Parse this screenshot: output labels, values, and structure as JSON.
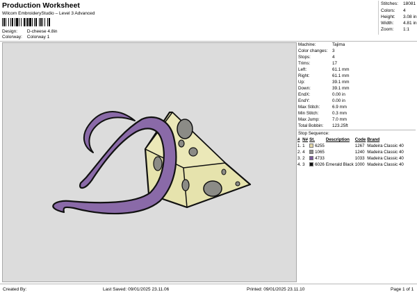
{
  "header": {
    "title": "Production Worksheet",
    "subtitle": "Wilcom EmbroideryStudio – Level 3 Advanced",
    "design_label": "Design:",
    "design_value": "D-cheese 4.8in",
    "colorway_label": "Colorway:",
    "colorway_value": "Colorway 1"
  },
  "stats": {
    "stitches_label": "Stitches:",
    "stitches": "18081",
    "colors_label": "Colors:",
    "colors": "4",
    "height_label": "Height:",
    "height": "3.08 in",
    "width_label": "Width:",
    "width": "4.81 in",
    "zoom_label": "Zoom:",
    "zoom": "1:1"
  },
  "machine_info": {
    "machine_label": "Machine:",
    "machine": "Tajima",
    "color_changes_label": "Color changes:",
    "color_changes": "3",
    "stops_label": "Stops:",
    "stops": "4",
    "trims_label": "Trims:",
    "trims": "17",
    "left_label": "Left:",
    "left": "61.1 mm",
    "right_label": "Right:",
    "right": "61.1 mm",
    "up_label": "Up:",
    "up": "39.1 mm",
    "down_label": "Down:",
    "down": "39.1 mm",
    "endx_label": "EndX:",
    "endx": "0.00 in",
    "endy_label": "EndY:",
    "endy": "0.00 in",
    "max_stitch_label": "Max Stitch:",
    "max_stitch": "6.9 mm",
    "min_stitch_label": "Min Stitch:",
    "min_stitch": "0.3 mm",
    "max_jump_label": "Max Jump:",
    "max_jump": "7.0 mm",
    "total_bobbin_label": "Total Bobbin:",
    "total_bobbin": "123.25ft"
  },
  "stop_sequence": {
    "title": "Stop Sequence:",
    "headers": [
      "#",
      "N#",
      "St.",
      "Description",
      "Code",
      "Brand"
    ],
    "rows": [
      {
        "stop": "1.",
        "n": "1",
        "st": "6255",
        "description": "",
        "code": "1267",
        "brand": "Madeira Classic 40",
        "color": "#e5d8a8"
      },
      {
        "stop": "2.",
        "n": "4",
        "st": "1065",
        "description": "",
        "code": "1240",
        "brand": "Madeira Classic 40",
        "color": "#8a8a8a"
      },
      {
        "stop": "3.",
        "n": "2",
        "st": "4733",
        "description": "",
        "code": "1033",
        "brand": "Madeira Classic 40",
        "color": "#7a5a9c"
      },
      {
        "stop": "4.",
        "n": "3",
        "st": "6026",
        "description": "Emerald Black",
        "code": "1000",
        "brand": "Madeira Classic 40",
        "color": "#111111"
      }
    ]
  },
  "footer": {
    "created_by": "Created By:",
    "last_saved": "Last Saved: 09/01/2025 23.11.06",
    "printed": "Printed: 09/01/2025 23.11.10",
    "page": "Page 1 of 1"
  },
  "colors": {
    "canvas_bg": "#dcdcdc",
    "cheese_fill": "#e6e3ad",
    "cheese_hole": "#8b8b86",
    "d_fill": "#8a6aa8",
    "outline": "#111111"
  }
}
